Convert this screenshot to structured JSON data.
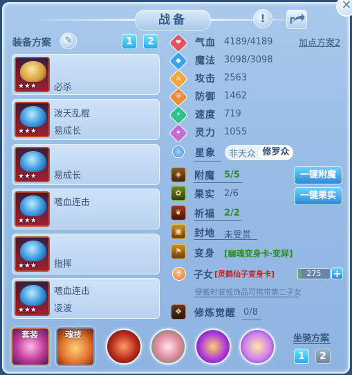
{
  "title": "战备",
  "scheme": {
    "label": "装备方案",
    "buttons": [
      "1",
      "2"
    ]
  },
  "add_plan": "加点方案2",
  "cards": [
    {
      "line1": "必杀",
      "line2": "",
      "stars": "★★★"
    },
    {
      "line1": "泼天乱棍",
      "line2": "易成长",
      "stars": "★★★"
    },
    {
      "line1": "易成长",
      "line2": "",
      "stars": "★★★"
    },
    {
      "line1": "嗜血连击",
      "line2": "",
      "stars": "★★★"
    },
    {
      "line1": "指挥",
      "line2": "",
      "stars": "★★★"
    },
    {
      "line1": "嗜血连击",
      "line2": "凌波",
      "stars": "★★★"
    }
  ],
  "stats": [
    {
      "name": "气血",
      "value": "4189/4189",
      "color": "#e7515f",
      "icon": "heart-icon"
    },
    {
      "name": "魔法",
      "value": "3098/3098",
      "color": "#3aa4f0",
      "icon": "mana-icon"
    },
    {
      "name": "攻击",
      "value": "2563",
      "color": "#f0a83a",
      "icon": "attack-icon"
    },
    {
      "name": "防御",
      "value": "1462",
      "color": "#f08a3a",
      "icon": "shield-icon"
    },
    {
      "name": "速度",
      "value": "719",
      "color": "#2cc48a",
      "icon": "speed-icon"
    },
    {
      "name": "灵力",
      "value": "1055",
      "color": "#c66ad8",
      "icon": "spirit-icon"
    }
  ],
  "star_sign": {
    "name": "星象",
    "options": [
      "非天众",
      "修罗众"
    ],
    "selected": "修罗众"
  },
  "rows": [
    {
      "name": "附魔",
      "value": "5/5"
    },
    {
      "name": "果实",
      "value": "2/6"
    },
    {
      "name": "祈福",
      "value": "2/2"
    },
    {
      "name": "封地",
      "value": "未受赏"
    },
    {
      "name": "变身",
      "value": "[幽魂变身卡·变异]"
    }
  ],
  "actions": {
    "enchant": "一键附魔",
    "fruit": "一键果实"
  },
  "child": {
    "label": "子女",
    "card": "[灵鹤仙子变身卡]",
    "value": "275",
    "fill": 0.1,
    "plus": "+",
    "hint": "穿戴时装或饰品可携带第二子女"
  },
  "cultivation": {
    "name": "修炼觉醒",
    "value": "0/8"
  },
  "bottom": {
    "tags": [
      "套装",
      "魂技"
    ]
  },
  "mount": {
    "label": "坐骑方案",
    "buttons": [
      "1",
      "2"
    ]
  }
}
